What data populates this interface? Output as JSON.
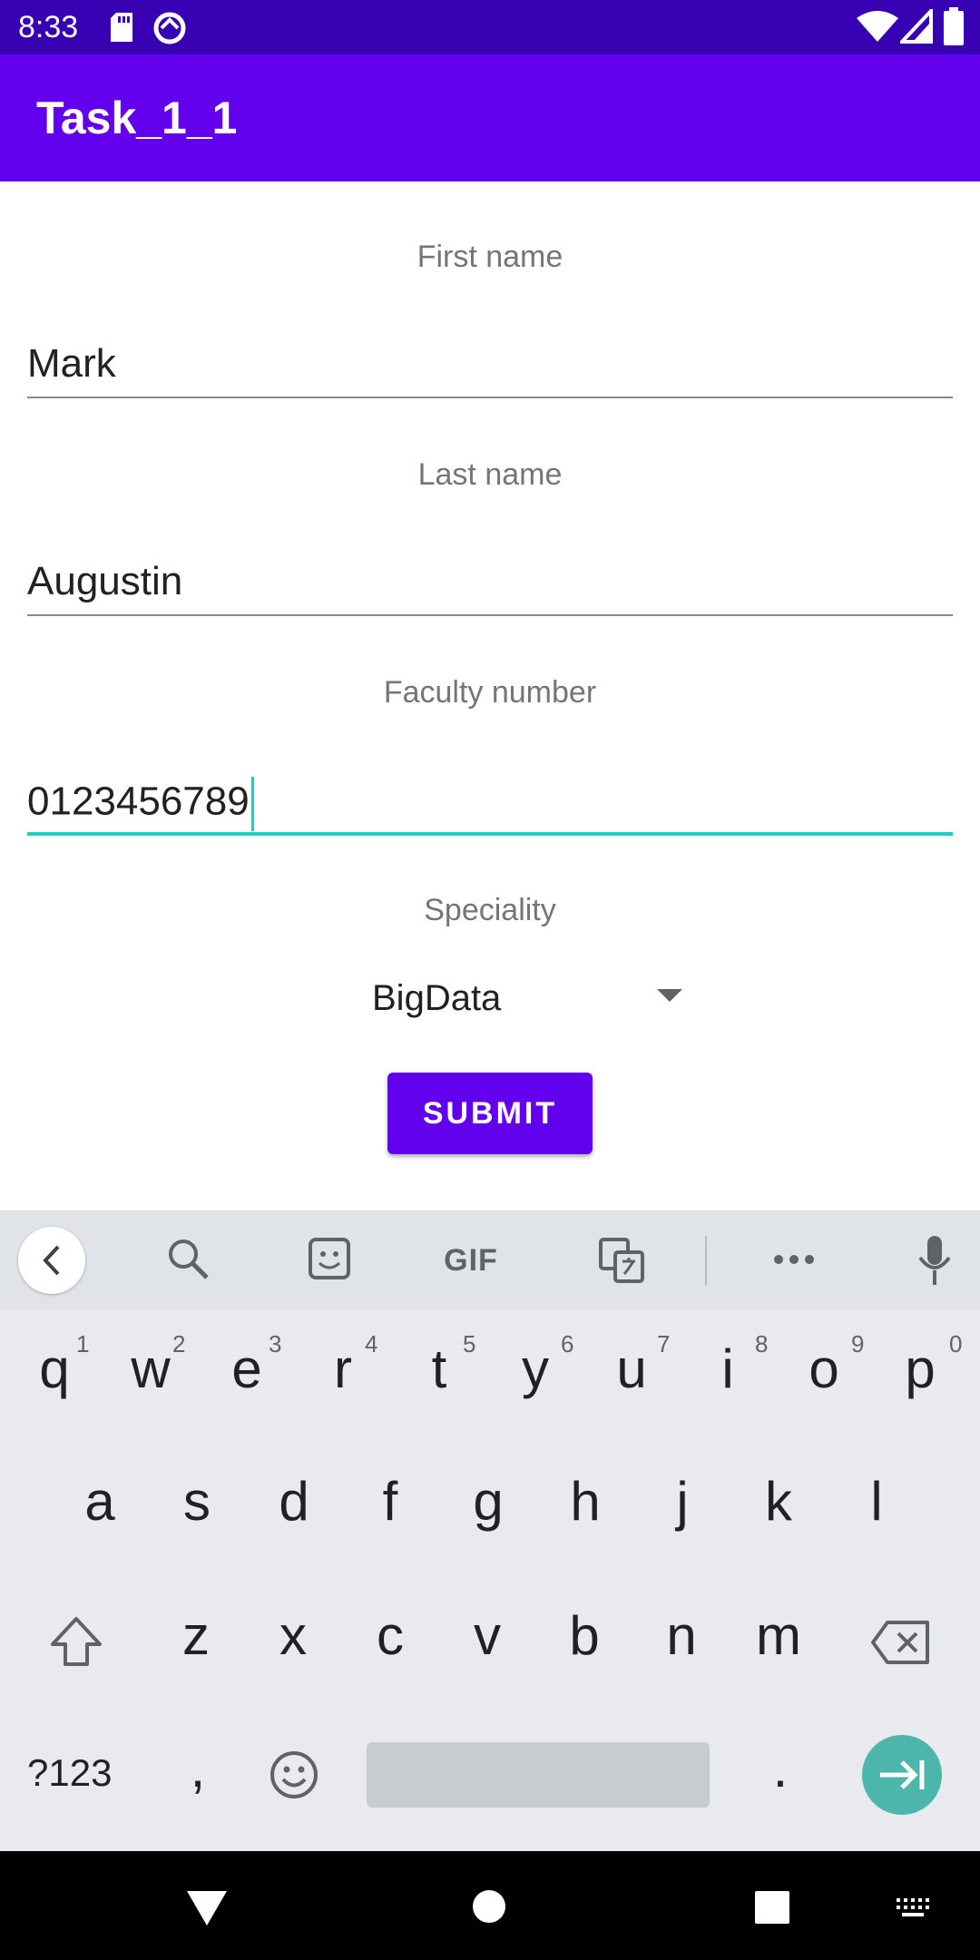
{
  "status_bar": {
    "time": "8:33"
  },
  "app_bar": {
    "title": "Task_1_1"
  },
  "form": {
    "first_name": {
      "label": "First name",
      "value": "Mark"
    },
    "last_name": {
      "label": "Last name",
      "value": "Augustin"
    },
    "faculty_number": {
      "label": "Faculty number",
      "value": "0123456789"
    },
    "speciality": {
      "label": "Speciality",
      "selected": "BigData"
    },
    "submit_label": "SUBMIT"
  },
  "keyboard": {
    "toolbar": {
      "gif_label": "GIF"
    },
    "row1": [
      "q",
      "w",
      "e",
      "r",
      "t",
      "y",
      "u",
      "i",
      "o",
      "p"
    ],
    "row1_hints": [
      "1",
      "2",
      "3",
      "4",
      "5",
      "6",
      "7",
      "8",
      "9",
      "0"
    ],
    "row2": [
      "a",
      "s",
      "d",
      "f",
      "g",
      "h",
      "j",
      "k",
      "l"
    ],
    "row3": [
      "z",
      "x",
      "c",
      "v",
      "b",
      "n",
      "m"
    ],
    "symbols_label": "?123",
    "comma": ",",
    "period": "."
  },
  "colors": {
    "primary": "#6200ee",
    "primary_dark": "#3700b3",
    "accent": "#1ecdc4",
    "enter_key": "#4db6ac"
  }
}
